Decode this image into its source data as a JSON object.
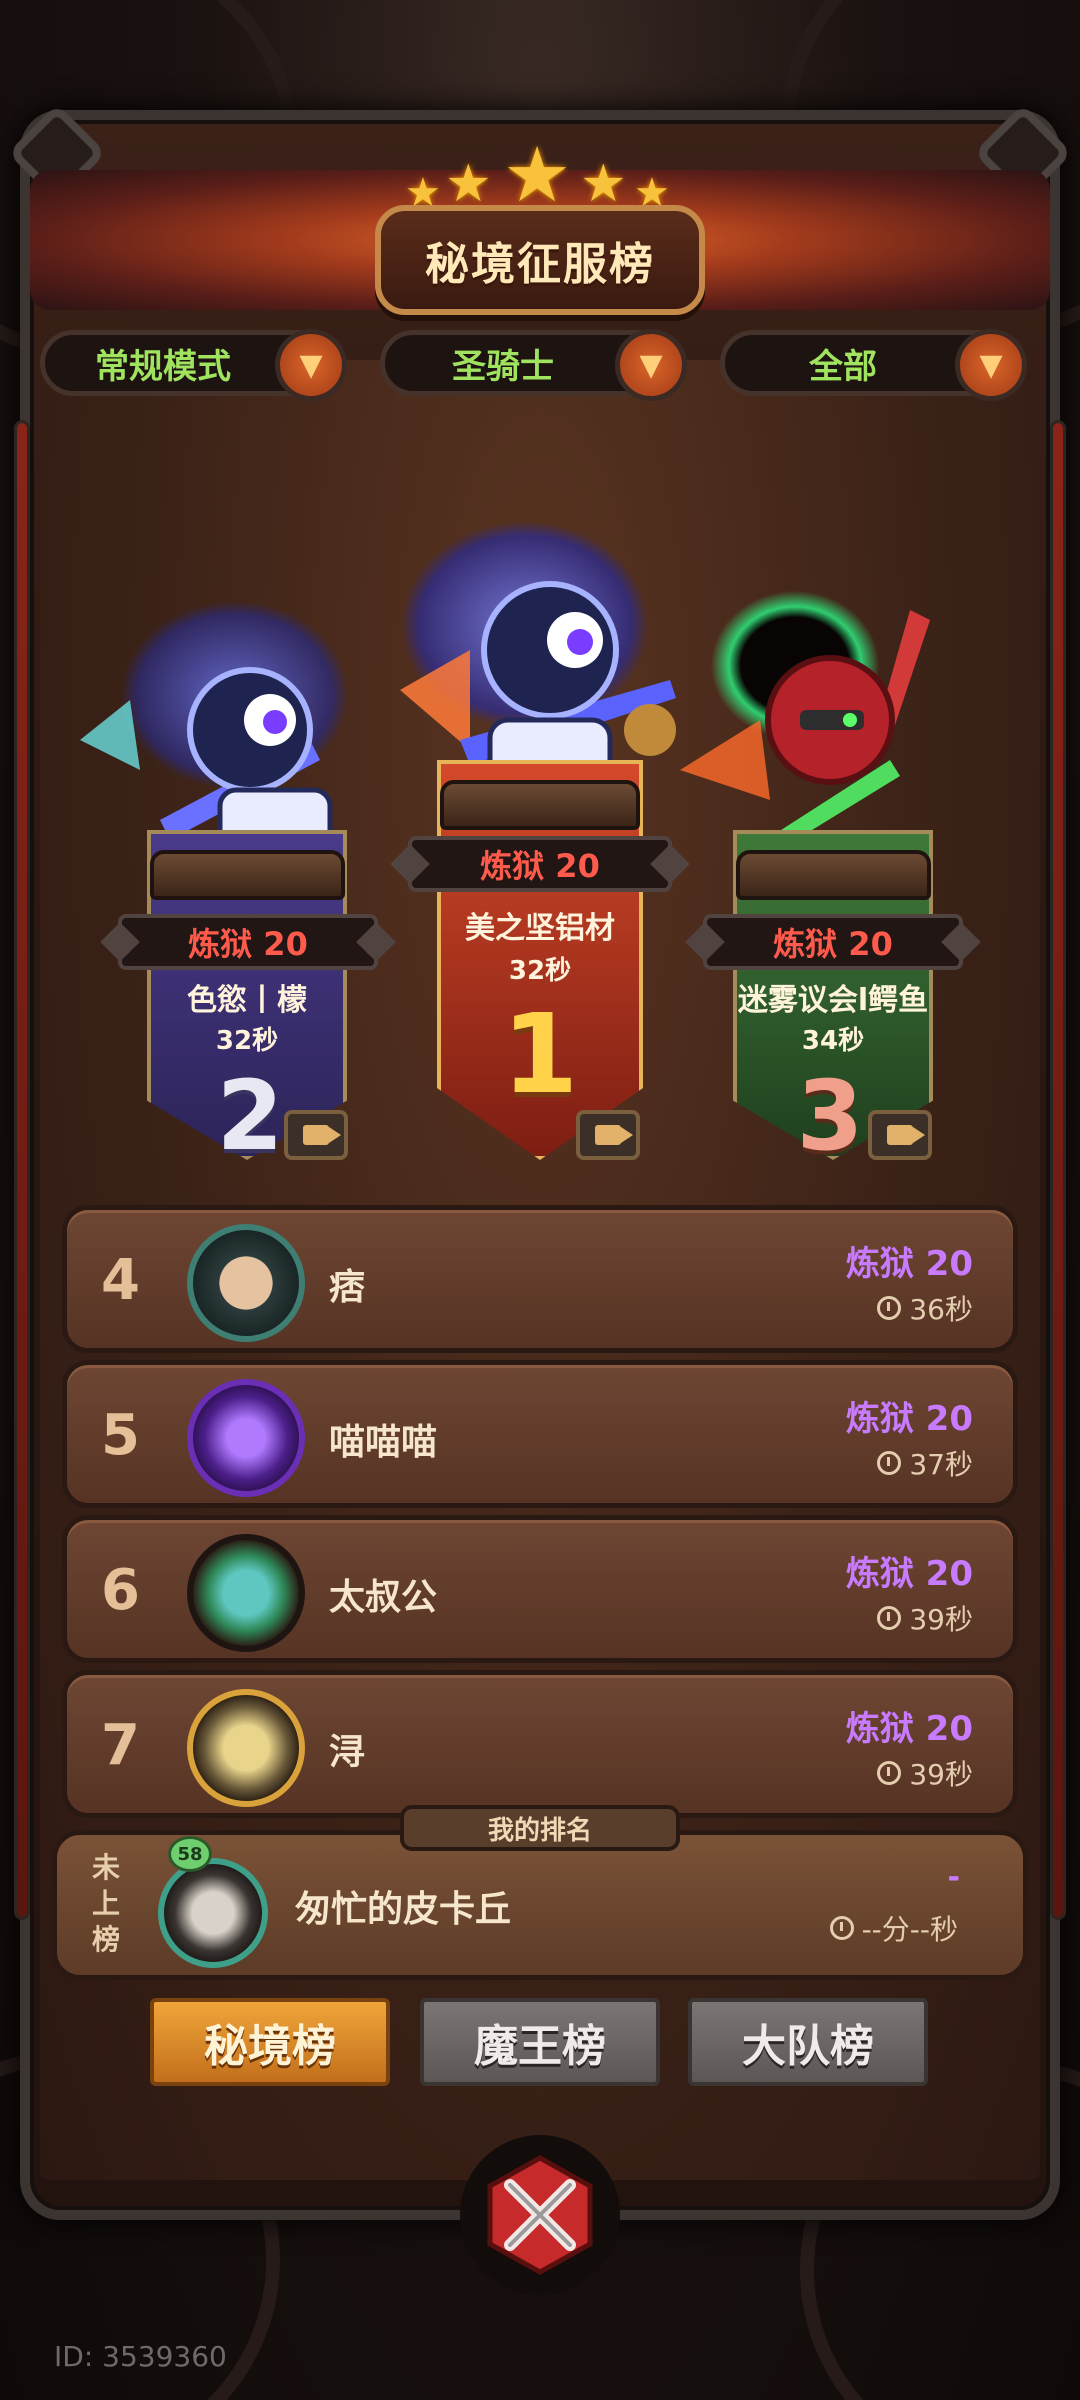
{
  "header": {
    "title": "秘境征服榜"
  },
  "filters": [
    {
      "label": "常规模式"
    },
    {
      "label": "圣骑士"
    },
    {
      "label": "全部"
    }
  ],
  "podium": {
    "first": {
      "difficulty": "炼狱 20",
      "name": "美之坚铝材",
      "time": "32秒",
      "rank": "1"
    },
    "second": {
      "difficulty": "炼狱 20",
      "name": "色慾丨檬",
      "time": "32秒",
      "rank": "2"
    },
    "third": {
      "difficulty": "炼狱 20",
      "name": "迷雾议会l鳄鱼",
      "time": "34秒",
      "rank": "3"
    }
  },
  "rankings": [
    {
      "rank": "4",
      "name": "痞",
      "difficulty": "炼狱 20",
      "time": "36秒"
    },
    {
      "rank": "5",
      "name": "喵喵喵",
      "difficulty": "炼狱 20",
      "time": "37秒"
    },
    {
      "rank": "6",
      "name": "太叔公",
      "difficulty": "炼狱 20",
      "time": "39秒"
    },
    {
      "rank": "7",
      "name": "浔",
      "difficulty": "炼狱 20",
      "time": "39秒"
    }
  ],
  "my_rank": {
    "tab_label": "我的排名",
    "status": "未上榜",
    "level_badge": "58",
    "name": "匆忙的皮卡丘",
    "difficulty": "-",
    "time": "--分--秒"
  },
  "tabs": [
    {
      "label": "秘境榜",
      "active": true
    },
    {
      "label": "魔王榜",
      "active": false
    },
    {
      "label": "大队榜",
      "active": false
    }
  ],
  "footer": {
    "id_text": "ID: 3539360"
  },
  "colors": {
    "accent_orange": "#e0862a",
    "filter_green": "#9fe35f",
    "difficulty_purple": "#c87bff",
    "difficulty_red": "#ff5b4d"
  }
}
